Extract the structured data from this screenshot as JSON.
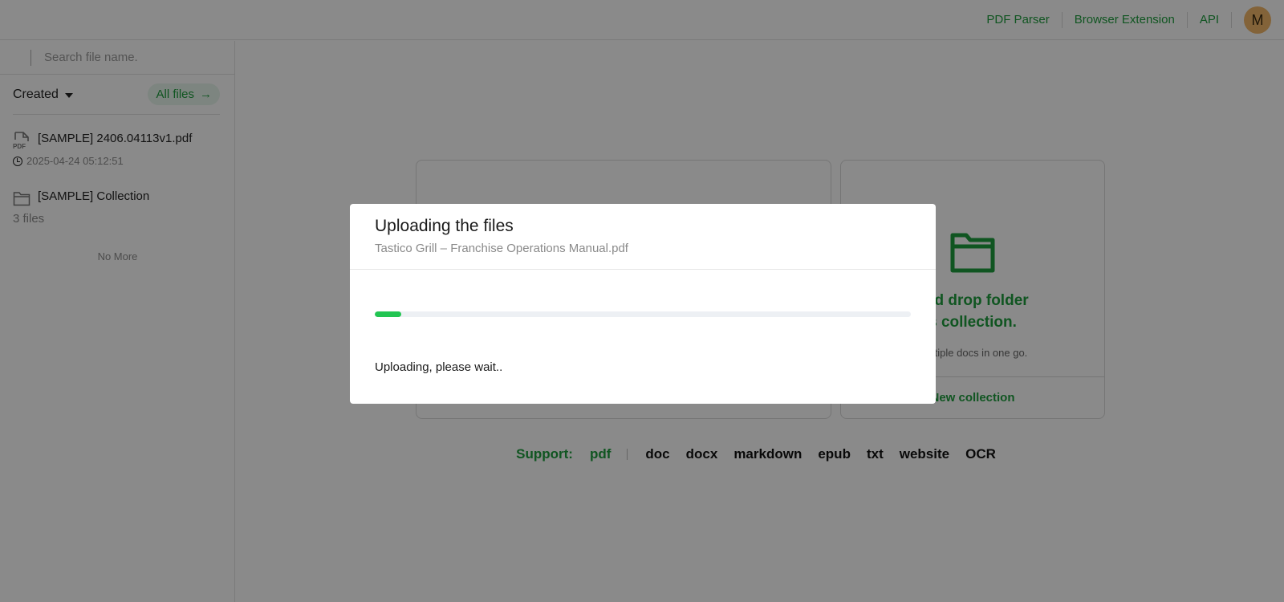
{
  "header": {
    "nav": [
      "PDF Parser",
      "Browser Extension",
      "API"
    ],
    "avatar_initial": "M"
  },
  "sidebar": {
    "search_placeholder": "Search file name.",
    "sort_label": "Created",
    "all_files_label": "All files",
    "items": [
      {
        "title": "[SAMPLE] 2406.04113v1.pdf",
        "sub": "2025-04-24 05:12:51",
        "icon": "pdf-file-icon"
      },
      {
        "title": "[SAMPLE] Collection",
        "sub": "3 files",
        "icon": "folder-icon"
      }
    ],
    "no_more": "No More"
  },
  "main": {
    "collection_card": {
      "title_line1": "and drop folder",
      "title_line2": "s collection.",
      "subtitle": "multiple docs in one go.",
      "button": "New collection"
    },
    "support": {
      "label": "Support:",
      "active_format": "pdf",
      "formats": [
        "doc",
        "docx",
        "markdown",
        "epub",
        "txt",
        "website",
        "OCR"
      ]
    }
  },
  "modal": {
    "title": "Uploading the files",
    "file_name": "Tastico Grill – Franchise Operations Manual.pdf",
    "progress_percent": 5,
    "status": "Uploading, please wait.."
  },
  "colors": {
    "accent": "#1e9e3e",
    "progress": "#22c552",
    "avatar": "#f3b86a"
  }
}
